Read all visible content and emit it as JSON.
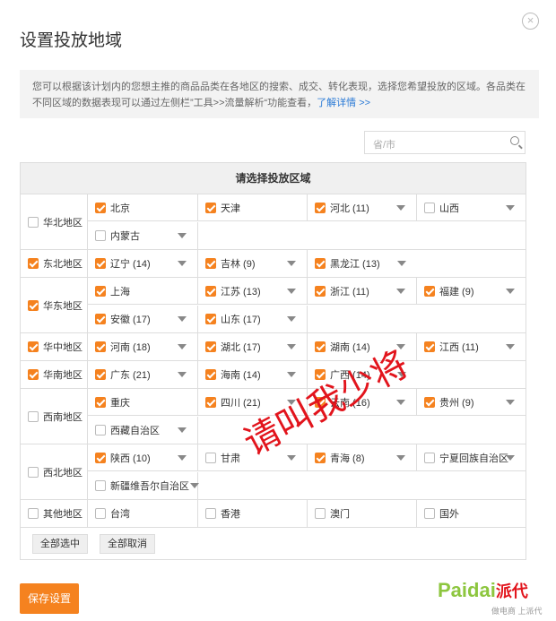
{
  "dialog": {
    "title": "设置投放地域",
    "close_label": "×",
    "notice": "您可以根据该计划内的您想主推的商品品类在各地区的搜索、成交、转化表现，选择您希望投放的区域。各品类在不同区域的数据表现可以通过左侧栏”工具>>流量解析“功能查看，",
    "notice_link": "了解详情 >>",
    "search_placeholder": "省/市",
    "table_header": "请选择投放区域",
    "select_all": "全部选中",
    "deselect_all": "全部取消",
    "save": "保存设置",
    "watermark": "请叫我少将",
    "logo_text": "Paidai",
    "logo_cn": "派代",
    "logo_slogan": "做电商 上派代"
  },
  "colors": {
    "accent": "#f5821f",
    "link": "#2a7ad6",
    "watermark": "#e2141c",
    "logo": "#8dc63f"
  },
  "groups": {
    "g0": {
      "name": "华北地区",
      "checked": false
    },
    "g1": {
      "name": "东北地区",
      "checked": true
    },
    "g2": {
      "name": "华东地区",
      "checked": true
    },
    "g3": {
      "name": "华中地区",
      "checked": true
    },
    "g4": {
      "name": "华南地区",
      "checked": true
    },
    "g5": {
      "name": "西南地区",
      "checked": false
    },
    "g6": {
      "name": "西北地区",
      "checked": false
    },
    "g7": {
      "name": "其他地区",
      "checked": false
    }
  },
  "provinces": {
    "p1": {
      "label": "北京",
      "checked": true
    },
    "p2": {
      "label": "天津",
      "checked": true
    },
    "p3": {
      "label": "河北 (11)",
      "checked": true
    },
    "p4": {
      "label": "山西",
      "checked": false
    },
    "p5": {
      "label": "内蒙古",
      "checked": false
    },
    "p6": {
      "label": "辽宁 (14)",
      "checked": true
    },
    "p7": {
      "label": "吉林 (9)",
      "checked": true
    },
    "p8": {
      "label": "黑龙江 (13)",
      "checked": true
    },
    "p9": {
      "label": "上海",
      "checked": true
    },
    "p10": {
      "label": "江苏 (13)",
      "checked": true
    },
    "p11": {
      "label": "浙江 (11)",
      "checked": true
    },
    "p12": {
      "label": "福建 (9)",
      "checked": true
    },
    "p13": {
      "label": "安徽 (17)",
      "checked": true
    },
    "p14": {
      "label": "山东 (17)",
      "checked": true
    },
    "p15": {
      "label": "河南 (18)",
      "checked": true
    },
    "p16": {
      "label": "湖北 (17)",
      "checked": true
    },
    "p17": {
      "label": "湖南 (14)",
      "checked": true
    },
    "p18": {
      "label": "江西 (11)",
      "checked": true
    },
    "p19": {
      "label": "广东 (21)",
      "checked": true
    },
    "p20": {
      "label": "海南 (14)",
      "checked": true
    },
    "p21": {
      "label": "广西 (14)",
      "checked": true
    },
    "p22": {
      "label": "重庆",
      "checked": true
    },
    "p23": {
      "label": "四川 (21)",
      "checked": true
    },
    "p24": {
      "label": "云南 (16)",
      "checked": true
    },
    "p25": {
      "label": "贵州 (9)",
      "checked": true
    },
    "p26": {
      "label": "西藏自治区",
      "checked": false
    },
    "p27": {
      "label": "陕西 (10)",
      "checked": true
    },
    "p28": {
      "label": "甘肃",
      "checked": false
    },
    "p29": {
      "label": "青海 (8)",
      "checked": true
    },
    "p30": {
      "label": "宁夏回族自治区",
      "checked": false
    },
    "p31": {
      "label": "新疆维吾尔自治区",
      "checked": false
    },
    "p32": {
      "label": "台湾",
      "checked": false
    },
    "p33": {
      "label": "香港",
      "checked": false
    },
    "p34": {
      "label": "澳门",
      "checked": false
    },
    "p35": {
      "label": "国外",
      "checked": false
    }
  }
}
